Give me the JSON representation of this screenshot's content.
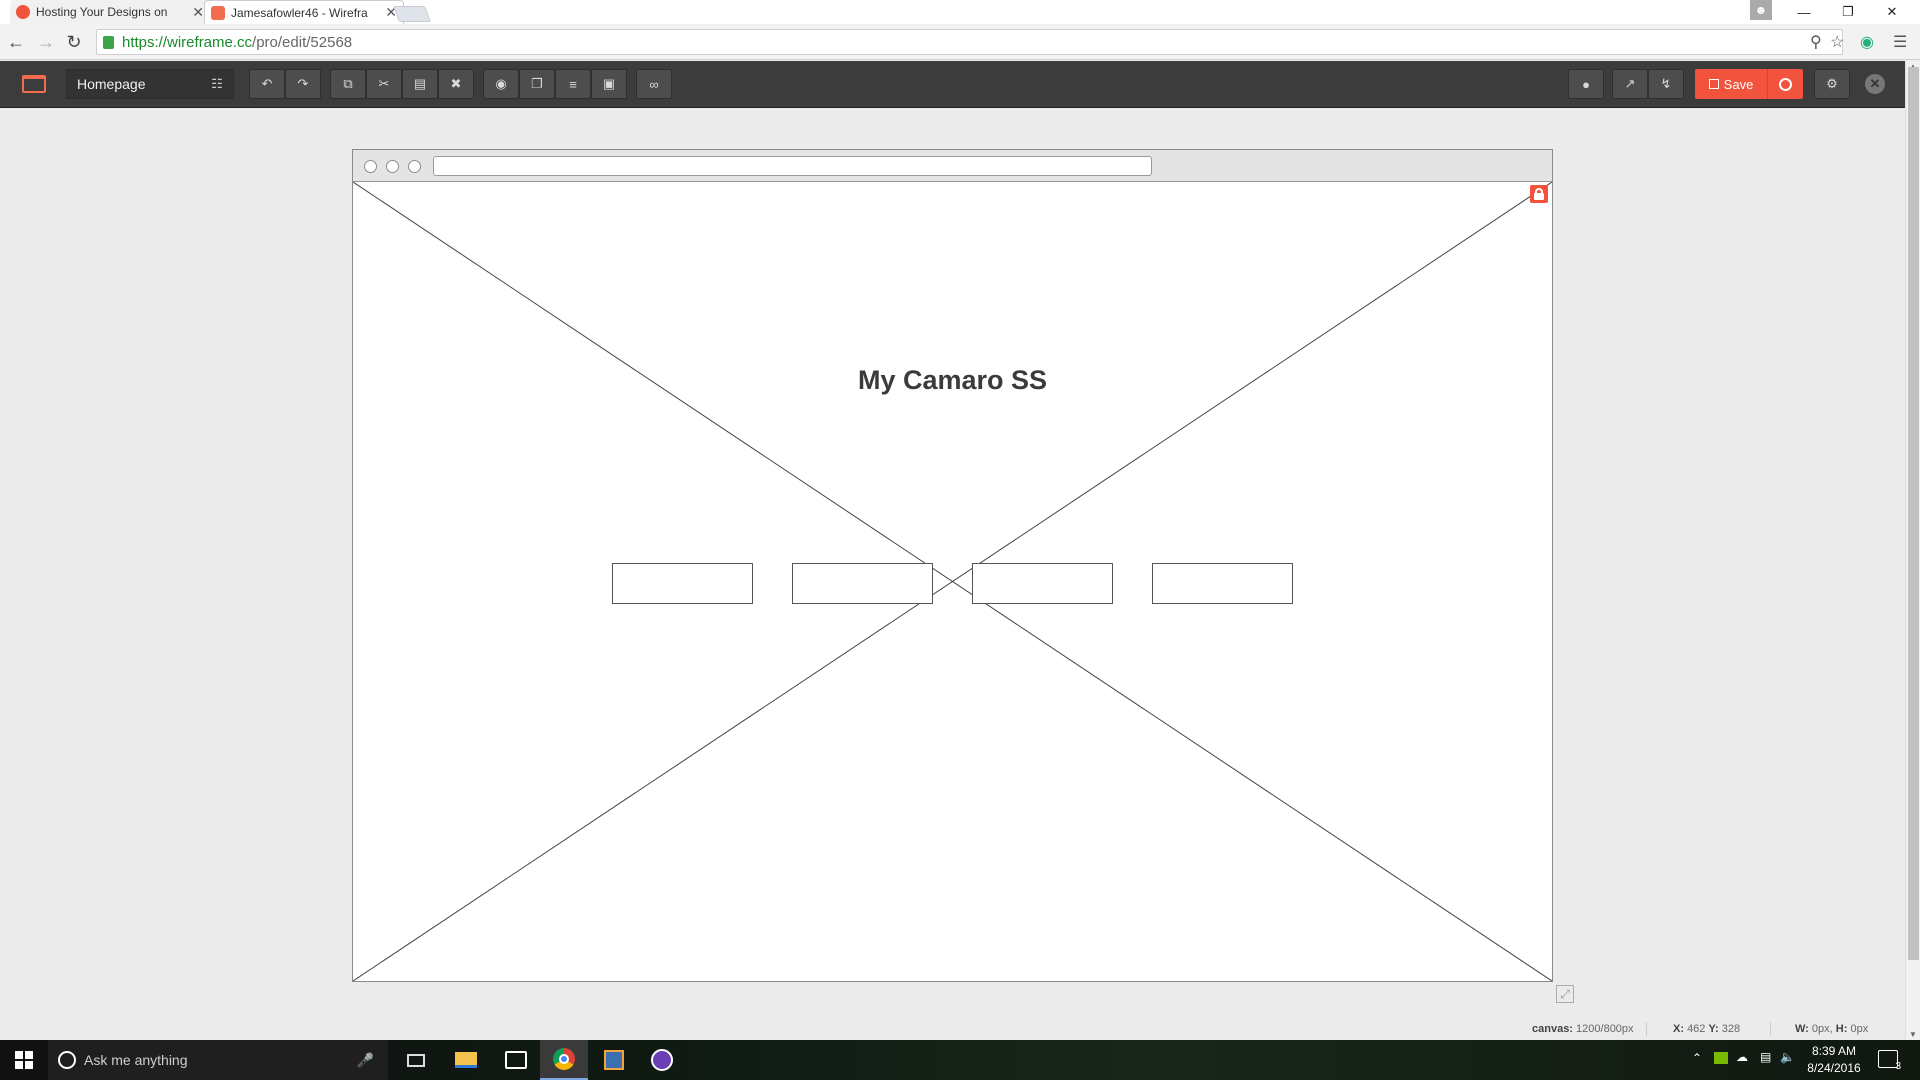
{
  "browser": {
    "tabs": [
      {
        "title": "Hosting Your Designs on",
        "favicon_color": "#f2533d"
      },
      {
        "title": "Jamesafowler46 - Wirefra",
        "favicon_color": "#f26c4f"
      }
    ],
    "url_host": "https://wireframe.cc",
    "url_path": "/pro/edit/52568"
  },
  "toolbar": {
    "page_name": "Homepage",
    "save_label": "Save",
    "accent_color": "#f2533d"
  },
  "canvas": {
    "heading": "My Camaro SS",
    "box_count": 4
  },
  "status": {
    "canvas_label": "canvas:",
    "canvas_value": "1200/800px",
    "x_label": "X:",
    "x_value": "462",
    "y_label": "Y:",
    "y_value": "328",
    "w_label": "W:",
    "w_value": "0px,",
    "h_label": "H:",
    "h_value": "0px"
  },
  "taskbar": {
    "search_placeholder": "Ask me anything",
    "time": "8:39 AM",
    "date": "8/24/2016",
    "notification_count": "3"
  }
}
